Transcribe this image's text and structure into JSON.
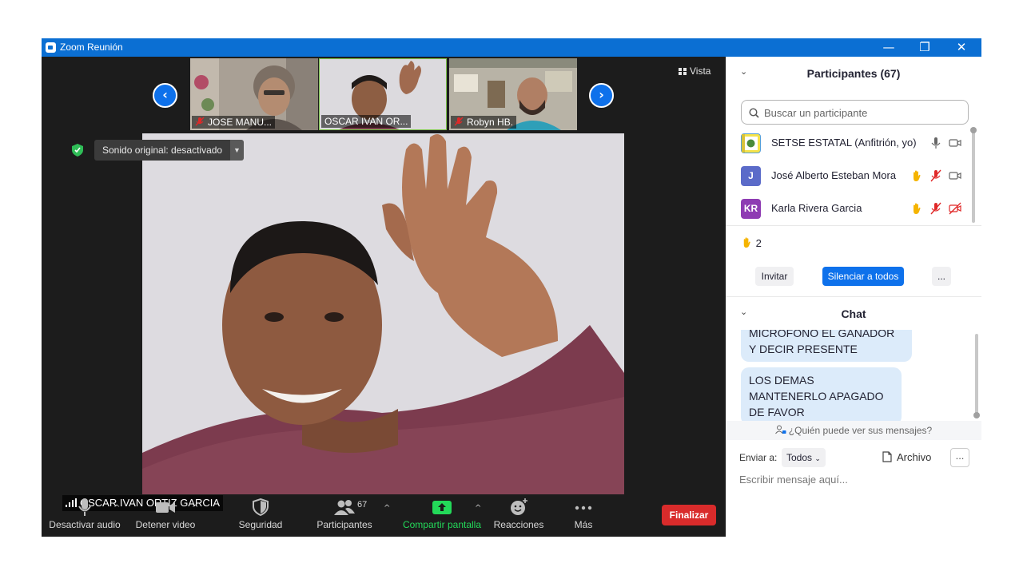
{
  "window": {
    "title": "Zoom Reunión",
    "controls": [
      "—",
      "❐",
      "✕"
    ]
  },
  "gallery": {
    "view_label": "Vista",
    "thumbnails": [
      {
        "name": "JOSE MANU...",
        "muted": true
      },
      {
        "name": "OSCAR IVAN OR...",
        "muted": false
      },
      {
        "name": "Robyn HB.",
        "muted": true
      }
    ]
  },
  "main_video": {
    "speaker_name": "OSCAR IVAN ORTIZ GARCIA",
    "original_sound": "Sonido original: desactivado"
  },
  "toolbar": {
    "audio": "Desactivar audio",
    "video": "Detener video",
    "security": "Seguridad",
    "participants": "Participantes",
    "participant_count": "67",
    "share": "Compartir pantalla",
    "reactions": "Reacciones",
    "more": "Más",
    "end": "Finalizar",
    "share_color": "#23d959"
  },
  "participants_panel": {
    "title": "Participantes (67)",
    "search_placeholder": "Buscar un participante",
    "list": [
      {
        "avatar": "",
        "name": "SETSE ESTATAL (Anfitrión, yo)",
        "hand": false,
        "mic_muted": false,
        "video_off": false
      },
      {
        "avatar": "J",
        "avatar_color": "#5b6bc9",
        "name": "José Alberto Esteban Mora",
        "hand": true,
        "mic_muted": true,
        "video_off": false
      },
      {
        "avatar": "KR",
        "avatar_color": "#8e3bb3",
        "name": "Karla Rivera Garcia",
        "hand": true,
        "mic_muted": true,
        "video_off": true
      }
    ],
    "raised_hands": "2",
    "invite": "Invitar",
    "mute_all": "Silenciar a todos",
    "more": "..."
  },
  "chat_panel": {
    "title": "Chat",
    "messages": [
      {
        "text": "MICRÓFONO EL GANADOR Y DECIR PRESENTE"
      },
      {
        "text": "LOS DEMAS MANTENERLO APAGADO DE FAVOR"
      }
    ],
    "who_can_see": "¿Quién puede ver sus mensajes?",
    "send_to_label": "Enviar a:",
    "send_to_value": "Todos",
    "file_label": "Archivo",
    "more": "...",
    "input_placeholder": "Escribir mensaje aquí..."
  }
}
